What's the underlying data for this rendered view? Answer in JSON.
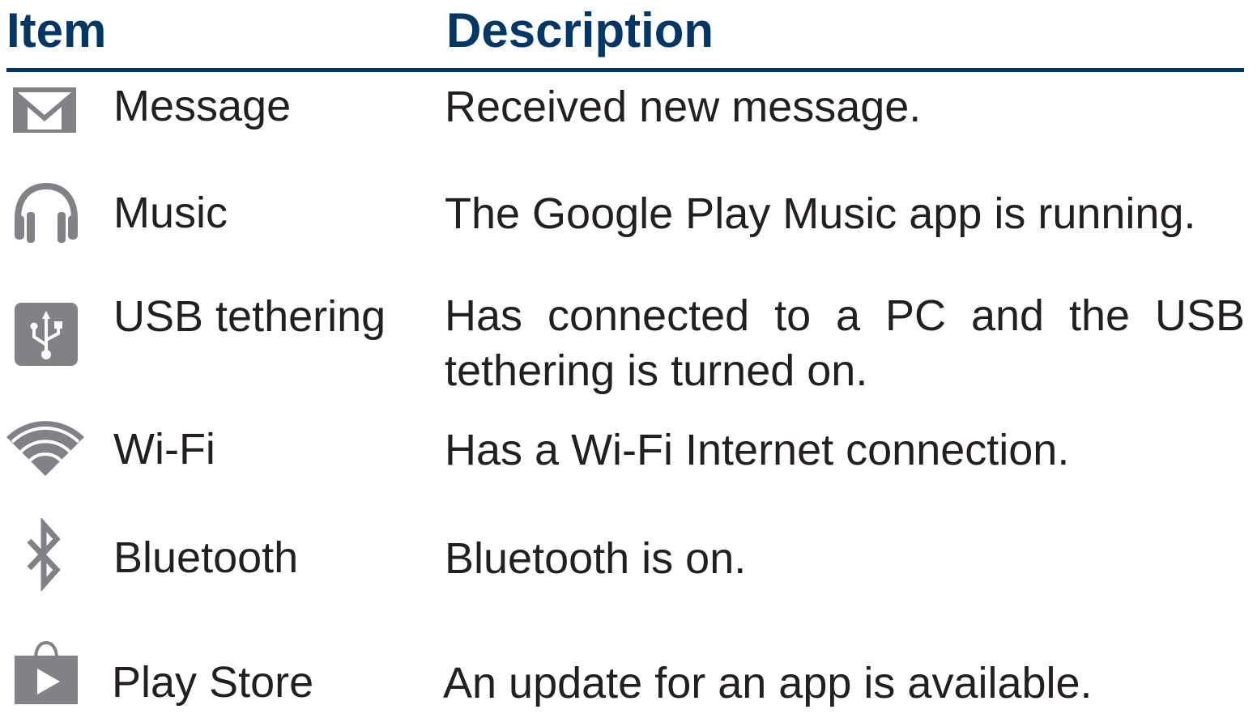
{
  "table": {
    "header": {
      "item": "Item",
      "description": "Description"
    },
    "rows": [
      {
        "icon": "gmail-envelope-icon",
        "item": "Message",
        "description": "Received new message."
      },
      {
        "icon": "headphones-icon",
        "item": "Music",
        "description": "The Google Play Music app is running."
      },
      {
        "icon": "usb-icon",
        "item": "USB tethering",
        "description": "Has connected to a PC and the USB tethering is turned on."
      },
      {
        "icon": "wifi-icon",
        "item": "Wi-Fi",
        "description": "Has a Wi-Fi Internet connection."
      },
      {
        "icon": "bluetooth-icon",
        "item": "Bluetooth",
        "description": "Bluetooth is on."
      },
      {
        "icon": "play-store-bag-icon",
        "item": "Play Store",
        "description": "An update for an app is available."
      }
    ]
  },
  "colors": {
    "header": "#003767",
    "text": "#231f20",
    "icon": "#808285"
  }
}
